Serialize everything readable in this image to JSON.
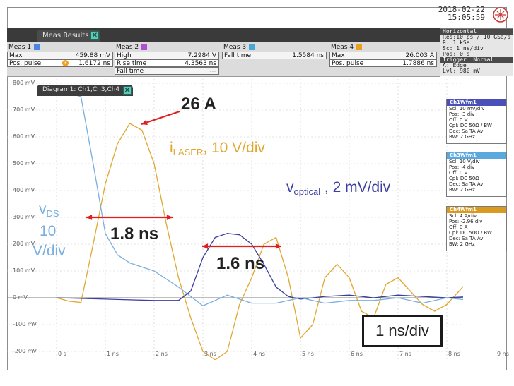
{
  "colors": {
    "laser": "#e0a830",
    "optical": "#3b3fa0",
    "vds": "#79aee0",
    "meas_accent": "#5fc7b2",
    "red_arrow": "#e01f1f",
    "m1": "#4b86e0",
    "m2": "#b050d0",
    "m3": "#49a6d8",
    "m4": "#e8a020"
  },
  "header": {
    "date": "2018-02-22",
    "time": "15:05:59"
  },
  "measurements": {
    "tab_label": "Meas Results",
    "close_icon": "close-icon",
    "columns": [
      {
        "title": "Meas 1",
        "rows": [
          {
            "label": "Max",
            "value": "459.88 mV"
          },
          {
            "label": "Pos. pulse",
            "value": "1.6172 ns"
          }
        ]
      },
      {
        "title": "Meas 2",
        "rows": [
          {
            "label": "High",
            "value": "7.2984 V"
          },
          {
            "label": "Rise time",
            "value": "4.3563 ns"
          },
          {
            "label": "Fall time",
            "value": "---"
          }
        ]
      },
      {
        "title": "Meas 3",
        "rows": [
          {
            "label": "Fall time",
            "value": "1.5584 ns"
          }
        ]
      },
      {
        "title": "Meas 4",
        "rows": [
          {
            "label": "Max",
            "value": "26.003 A"
          },
          {
            "label": "Pos. pulse",
            "value": "1.7886 ns"
          }
        ]
      }
    ]
  },
  "horizontal": {
    "title": "Horizontal",
    "lines": [
      "Res:10 ps / 10 GSa/s",
      "R: 1 kSa",
      "Sc: 1 ns/div",
      "Pos: 0 s"
    ],
    "trigger_title": "Trigger",
    "trigger_mode": "Normal",
    "trigger_lines": [
      "A: Edge",
      "Lvl: 980 mV"
    ]
  },
  "diagram": {
    "tab_label": "Diagram1: Ch1,Ch3,Ch4"
  },
  "plot": {
    "y_ticks": [
      "800 mV",
      "700 mV",
      "600 mV",
      "500 mV",
      "400 mV",
      "300 mV",
      "200 mV",
      "100 mV",
      "0 mV",
      "-100 mV",
      "-200 mV"
    ],
    "x_ticks": [
      "0 s",
      "1 ns",
      "2 ns",
      "3 ns",
      "4 ns",
      "5 ns",
      "6 ns",
      "7 ns",
      "8 ns",
      "9 ns"
    ]
  },
  "waveforms": [
    {
      "title": "Ch1Wfm1",
      "lines": [
        "Scl: 10 mV/div",
        "Pos: -3 div",
        "Off: 0 V",
        "Cpl: DC 50Ω / BW",
        "Dec: Sa  TA  Av",
        "BW: 2 GHz"
      ]
    },
    {
      "title": "Ch3Wfm1",
      "lines": [
        "Scl: 10 V/div",
        "Pos: -4 div",
        "Off: 0 V",
        "Cpl: DC 50Ω",
        "Dec: Sa  TA  Av",
        "BW: 2 GHz"
      ]
    },
    {
      "title": "Ch4Wfm1",
      "lines": [
        "Scl: 4 A/div",
        "Pos: -2.96 div",
        "Off: 0 A",
        "Cpl: DC 50Ω / BW",
        "Dec: Sa  TA  Av",
        "BW: 2 GHz"
      ]
    }
  ],
  "annotations": {
    "peak_current": "26 A",
    "laser_label": "i",
    "laser_sub": "LASER",
    "laser_scale": ", 10 V/div",
    "optical_label": "v",
    "optical_sub": "optical",
    "optical_scale": " , 2 mV/div",
    "vds_label": "v",
    "vds_sub": "DS",
    "vds_scale_1": "10",
    "vds_scale_2": "V/div",
    "width_laser": "1.8 ns",
    "width_optical": "1.6 ns",
    "timebase": "1 ns/div"
  },
  "chart_data": {
    "type": "line",
    "xlabel": "",
    "ylabel": "",
    "x_unit": "ns",
    "series": [
      {
        "name": "iLASER",
        "x": [
          0,
          0.25,
          0.5,
          0.75,
          1.0,
          1.25,
          1.5,
          1.75,
          2.0,
          2.25,
          2.5,
          2.75,
          3.0,
          3.25,
          3.5,
          3.75,
          4.0,
          4.25,
          4.5,
          4.75,
          5.0,
          5.25,
          5.5,
          5.75,
          6.0,
          6.25,
          6.5,
          6.75,
          7.0,
          7.25,
          7.5,
          7.75,
          8.0,
          8.25,
          8.5,
          8.75,
          9.0,
          9.25,
          9.5
        ],
        "y": [
          0,
          -0.5,
          -0.7,
          8,
          17,
          23,
          26,
          25,
          20,
          11,
          3,
          -3,
          -8,
          -11,
          -8,
          -1,
          3,
          8,
          9,
          3,
          -6,
          -4,
          3,
          5,
          3,
          -2,
          -3,
          2,
          3,
          1,
          -1,
          -2,
          -1,
          1,
          3,
          4,
          3,
          1,
          2
        ]
      },
      {
        "name": "voptical",
        "x": [
          0,
          0.5,
          1.0,
          1.5,
          2.0,
          2.5,
          2.75,
          3.0,
          3.25,
          3.5,
          3.75,
          4.0,
          4.25,
          4.5,
          4.75,
          5.0,
          5.5,
          6.0,
          6.5,
          7.0,
          7.5,
          8.0,
          8.5,
          9.0,
          9.5
        ],
        "y": [
          0,
          -0.05,
          -0.1,
          -0.15,
          -0.2,
          -0.2,
          0.5,
          3.0,
          4.5,
          4.8,
          4.7,
          4.0,
          2.5,
          0.8,
          0.1,
          -0.1,
          0.1,
          0.2,
          0.0,
          0.2,
          0.1,
          0.0,
          0.1,
          0.1,
          0.0
        ]
      },
      {
        "name": "vDS",
        "x": [
          0,
          0.5,
          0.75,
          1.0,
          1.25,
          1.5,
          2.0,
          2.5,
          3.0,
          3.25,
          3.5,
          4.0,
          4.5,
          5.0,
          5.5,
          6.0,
          6.5,
          7.0,
          7.5,
          8.0,
          8.5,
          9.0,
          9.5
        ],
        "y": [
          78,
          75,
          50,
          24,
          16,
          13,
          10,
          4,
          -3,
          -1,
          1,
          -2,
          -2,
          0,
          -2,
          -1,
          -1,
          0,
          -2,
          0,
          -1,
          0,
          -1
        ]
      }
    ]
  }
}
